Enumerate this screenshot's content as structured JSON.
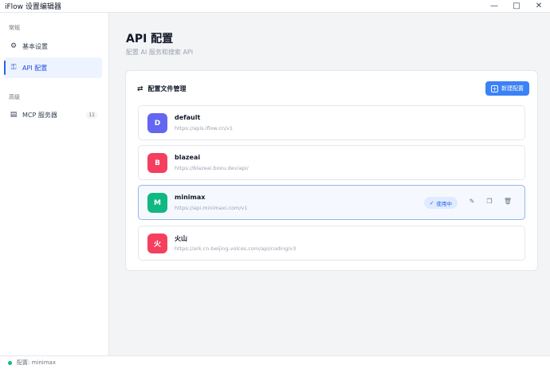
{
  "window": {
    "title": "iFlow 设置编辑器"
  },
  "sidebar": {
    "sections": [
      {
        "label": "常规",
        "items": [
          {
            "label": "基本设置",
            "icon": "gear-icon"
          },
          {
            "label": "API 配置",
            "icon": "key-icon",
            "active": true
          }
        ]
      },
      {
        "label": "高级",
        "items": [
          {
            "label": "MCP 服务器",
            "icon": "server-icon",
            "count": "11"
          }
        ]
      }
    ]
  },
  "main": {
    "title": "API 配置",
    "subtitle": "配置 AI 服务和搜索 API",
    "panel": {
      "title": "配置文件管理",
      "new_button": "新建配置",
      "profiles": [
        {
          "initial": "D",
          "name": "default",
          "url": "https://apis.iflow.cn/v1",
          "color": "#6366f1"
        },
        {
          "initial": "B",
          "name": "blazeai",
          "url": "https://blazeai.boxu.dev/api/",
          "color": "#f43f5e"
        },
        {
          "initial": "M",
          "name": "minimax",
          "url": "https://api.minimaxi.com/v1",
          "color": "#10b981",
          "active": true,
          "badge": "使用中"
        },
        {
          "initial": "火",
          "name": "火山",
          "url": "https://ark.cn-beijing.volces.com/api/coding/v3",
          "color": "#f43f5e"
        }
      ]
    }
  },
  "status": {
    "text": "配置: minimax",
    "color": "#10b981"
  }
}
